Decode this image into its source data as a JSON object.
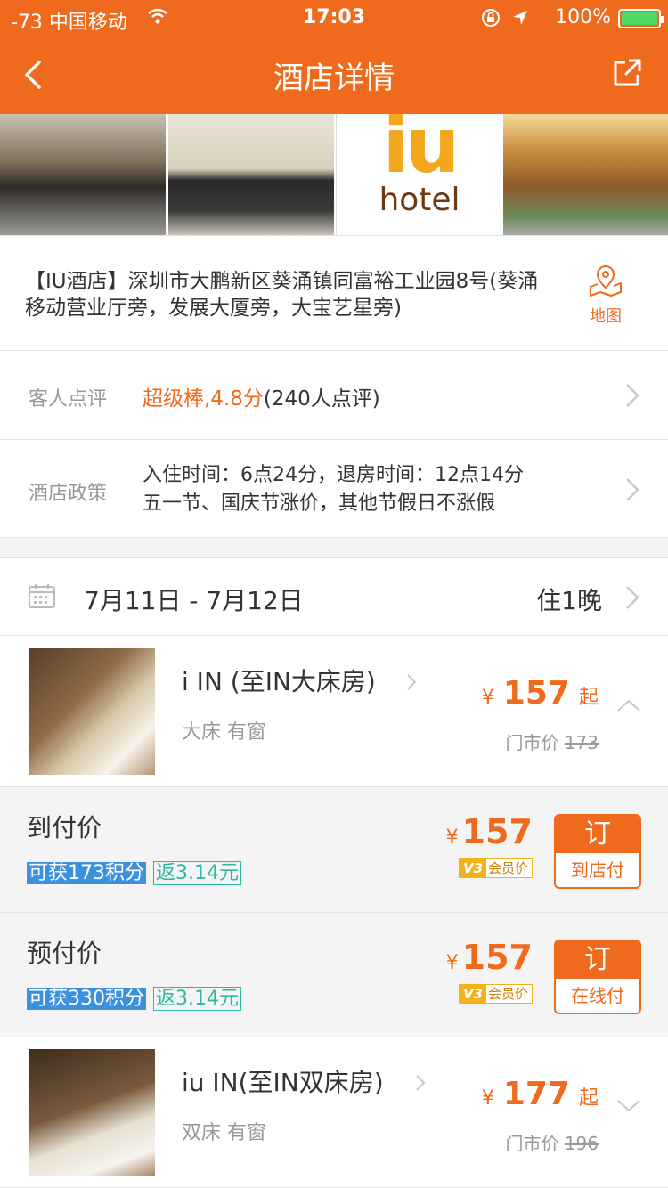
{
  "status_bar": {
    "signal": "-73 中国移动",
    "time": "17:03",
    "battery": "100%"
  },
  "nav": {
    "title": "酒店详情"
  },
  "photos": {
    "logo_main": "iu",
    "logo_sub": "hotel"
  },
  "address": {
    "text": "【IU酒店】深圳市大鹏新区葵涌镇同富裕工业园8号(葵涌移动营业厅旁，发展大厦旁，大宝艺星旁)",
    "map_label": "地图"
  },
  "review": {
    "label": "客人点评",
    "score_text": "超级棒,4.8分",
    "count_text": "(240人点评)"
  },
  "policy": {
    "label": "酒店政策",
    "line1": "入住时间：6点24分，退房时间：12点14分",
    "line2": "五一节、国庆节涨价，其他节假日不涨假"
  },
  "dates": {
    "range": "7月11日 - 7月12日",
    "nights": "住1晚"
  },
  "rooms": [
    {
      "name": "i IN (至IN大床房)",
      "tags": "大床  有窗",
      "price_symbol": "¥",
      "price": "157",
      "price_suffix": "起",
      "msrp_label": "门市价",
      "msrp": "173"
    },
    {
      "name": "iu IN(至IN双床房)",
      "tags": "双床  有窗",
      "price_symbol": "¥",
      "price": "177",
      "price_suffix": "起",
      "msrp_label": "门市价",
      "msrp": "196"
    }
  ],
  "rates": [
    {
      "title": "到付价",
      "points": "可获173积分",
      "cashback": "返3.14元",
      "price_symbol": "¥",
      "price": "157",
      "member_badge": "V3",
      "member_label": "会员价",
      "book_label": "订",
      "book_sub": "到店付"
    },
    {
      "title": "预付价",
      "points": "可获330积分",
      "cashback": "返3.14元",
      "price_symbol": "¥",
      "price": "157",
      "member_badge": "V3",
      "member_label": "会员价",
      "book_label": "订",
      "book_sub": "在线付"
    }
  ],
  "colors": {
    "brand": "#ef6a1c",
    "points": "#3b90e0",
    "cashback": "#2fb8a0",
    "member": "#f2b21b"
  },
  "icons": [
    "back-arrow-icon",
    "share-icon",
    "map-pin-icon",
    "chevron-right-icon",
    "calendar-icon",
    "chevron-up-icon",
    "chevron-down-icon",
    "wifi-icon",
    "location-arrow-icon",
    "rotation-lock-icon",
    "battery-icon"
  ]
}
